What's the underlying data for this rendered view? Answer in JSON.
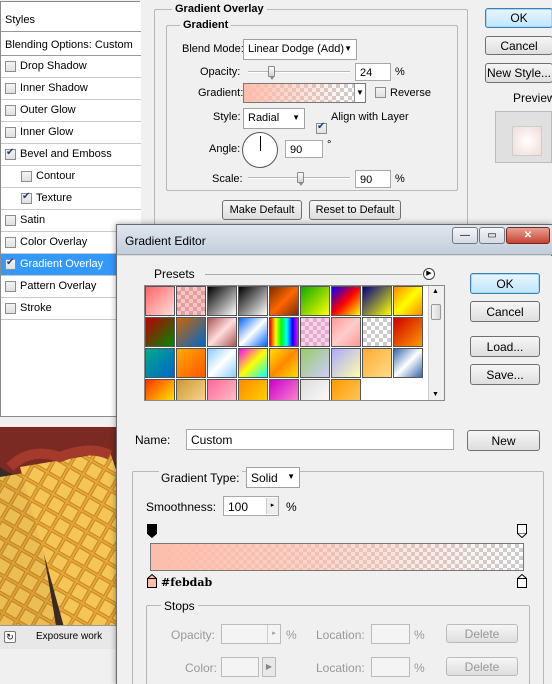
{
  "styles_panel": {
    "title": "Styles",
    "blending_options": "Blending Options: Custom",
    "items": [
      {
        "label": "Drop Shadow",
        "checked": false,
        "indent": false,
        "selected": false
      },
      {
        "label": "Inner Shadow",
        "checked": false,
        "indent": false,
        "selected": false
      },
      {
        "label": "Outer Glow",
        "checked": false,
        "indent": false,
        "selected": false
      },
      {
        "label": "Inner Glow",
        "checked": false,
        "indent": false,
        "selected": false
      },
      {
        "label": "Bevel and Emboss",
        "checked": true,
        "indent": false,
        "selected": false
      },
      {
        "label": "Contour",
        "checked": false,
        "indent": true,
        "selected": false
      },
      {
        "label": "Texture",
        "checked": true,
        "indent": true,
        "selected": false
      },
      {
        "label": "Satin",
        "checked": false,
        "indent": false,
        "selected": false
      },
      {
        "label": "Color Overlay",
        "checked": false,
        "indent": false,
        "selected": false
      },
      {
        "label": "Gradient Overlay",
        "checked": true,
        "indent": false,
        "selected": true
      },
      {
        "label": "Pattern Overlay",
        "checked": false,
        "indent": false,
        "selected": false
      },
      {
        "label": "Stroke",
        "checked": false,
        "indent": false,
        "selected": false
      }
    ]
  },
  "gradient_overlay": {
    "section_title": "Gradient Overlay",
    "group_title": "Gradient",
    "blend_mode_label": "Blend Mode:",
    "blend_mode_value": "Linear Dodge (Add)",
    "opacity_label": "Opacity:",
    "opacity_value": "24",
    "opacity_unit": "%",
    "opacity_level": 24,
    "gradient_label": "Gradient:",
    "reverse_label": "Reverse",
    "style_label": "Style:",
    "style_value": "Radial",
    "align_label": "Align with Layer",
    "angle_label": "Angle:",
    "angle_value": "90",
    "angle_unit": "°",
    "scale_label": "Scale:",
    "scale_value": "90",
    "scale_unit": "%",
    "make_default": "Make Default",
    "reset_default": "Reset to Default"
  },
  "layer_style_buttons": {
    "ok": "OK",
    "cancel": "Cancel",
    "new_style": "New Style...",
    "preview": "Preview"
  },
  "behind": {
    "tab_label": "Exposure work"
  },
  "gradient_editor": {
    "title": "Gradient Editor",
    "presets_label": "Presets",
    "ok": "OK",
    "cancel": "Cancel",
    "load": "Load...",
    "save": "Save...",
    "name_label": "Name:",
    "name_value": "Custom",
    "new_button": "New",
    "gradient_type_label": "Gradient Type:",
    "gradient_type_value": "Solid",
    "smoothness_label": "Smoothness:",
    "smoothness_value": "100",
    "smoothness_unit": "%",
    "color_stop_hex": "#febdab",
    "stops_label": "Stops",
    "opacity_label": "Opacity:",
    "opacity_unit": "%",
    "location_label": "Location:",
    "location_unit": "%",
    "color_label": "Color:",
    "delete_label": "Delete"
  },
  "colors": {
    "selection": "#3399ff",
    "gradient_color": "#febdab"
  }
}
